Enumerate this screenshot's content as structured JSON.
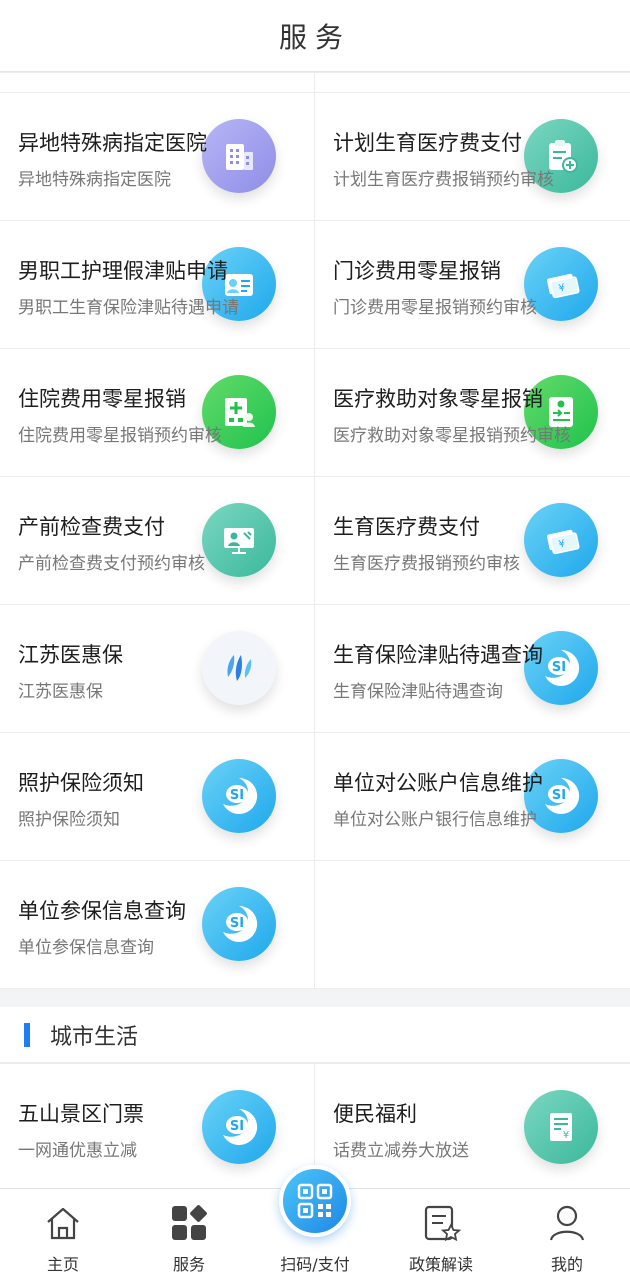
{
  "header": {
    "title": "服务"
  },
  "services": [
    [
      {
        "title": "异地特殊病指定医院",
        "sub": "异地特殊病指定医院",
        "icon": "hospital-building-icon",
        "color": "purple"
      },
      {
        "title": "计划生育医疗费支付",
        "sub": "计划生育医疗费报销预约审核",
        "icon": "clipboard-medical-icon",
        "color": "teal"
      }
    ],
    [
      {
        "title": "男职工护理假津贴申请",
        "sub": "男职工生育保险津贴待遇申请",
        "icon": "id-card-icon",
        "color": "blue"
      },
      {
        "title": "门诊费用零星报销",
        "sub": "门诊费用零星报销预约审核",
        "icon": "banknote-icon",
        "color": "blue"
      }
    ],
    [
      {
        "title": "住院费用零星报销",
        "sub": "住院费用零星报销预约审核",
        "icon": "hospital-cross-icon",
        "color": "green"
      },
      {
        "title": "医疗救助对象零星报销",
        "sub": "医疗救助对象零星报销预约审核",
        "icon": "medical-document-icon",
        "color": "green"
      }
    ],
    [
      {
        "title": "产前检查费支付",
        "sub": "产前检查费支付预约审核",
        "icon": "monitor-person-icon",
        "color": "teal"
      },
      {
        "title": "生育医疗费支付",
        "sub": "生育医疗费报销预约审核",
        "icon": "banknote-icon",
        "color": "blue"
      }
    ],
    [
      {
        "title": "江苏医惠保",
        "sub": "江苏医惠保",
        "icon": "leaf-logo-icon",
        "color": "white"
      },
      {
        "title": "生育保险津贴待遇查询",
        "sub": "生育保险津贴待遇查询",
        "icon": "si-logo-icon",
        "color": "blue"
      }
    ],
    [
      {
        "title": "照护保险须知",
        "sub": "照护保险须知",
        "icon": "si-logo-icon",
        "color": "blue"
      },
      {
        "title": "单位对公账户信息维护",
        "sub": "单位对公账户银行信息维护",
        "icon": "si-logo-icon",
        "color": "blue"
      }
    ],
    [
      {
        "title": "单位参保信息查询",
        "sub": "单位参保信息查询",
        "icon": "si-logo-icon",
        "color": "blue"
      },
      null
    ]
  ],
  "city_section": {
    "title": "城市生活"
  },
  "city_items": [
    {
      "title": "五山景区门票",
      "sub": "一网通优惠立减",
      "icon": "si-logo-icon",
      "color": "blue"
    },
    {
      "title": "便民福利",
      "sub": "话费立减券大放送",
      "icon": "receipt-icon",
      "color": "teal"
    }
  ],
  "nav": {
    "home": "主页",
    "services": "服务",
    "scan": "扫码/支付",
    "policy": "政策解读",
    "mine": "我的"
  }
}
